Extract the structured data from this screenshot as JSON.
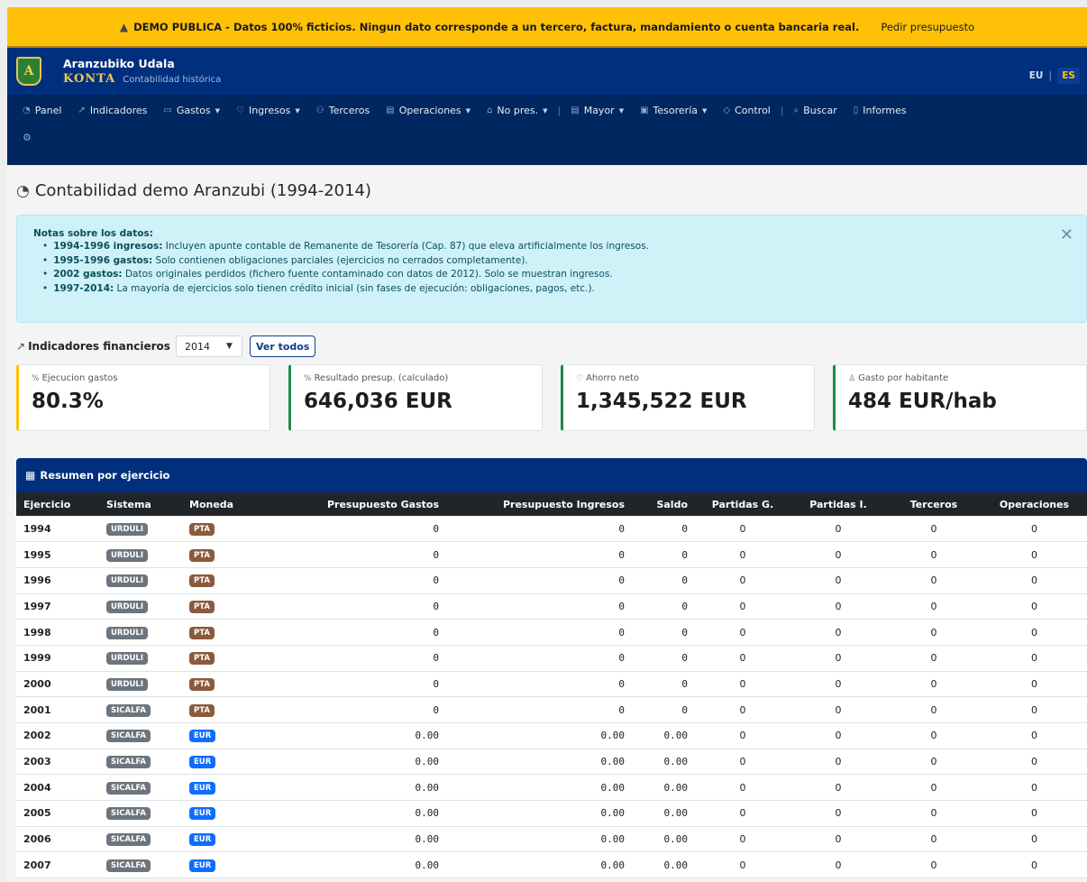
{
  "banner": {
    "message": "DEMO PUBLICA - Datos 100% ficticios. Ningun dato corresponde a un tercero, factura, mandamiento o cuenta bancaria real.",
    "cta": "Pedir presupuesto"
  },
  "brand": {
    "logo_letter": "A",
    "name": "Aranzubiko Udala",
    "product": "KONTA",
    "tagline": "Contabilidad histórica"
  },
  "lang": {
    "eu": "EU",
    "sep": "|",
    "es": "ES"
  },
  "nav": [
    {
      "label": "Panel",
      "icon": "dashboard-icon",
      "dropdown": false
    },
    {
      "label": "Indicadores",
      "icon": "chart-line-icon",
      "dropdown": false
    },
    {
      "label": "Gastos",
      "icon": "wallet-icon",
      "dropdown": true
    },
    {
      "label": "Ingresos",
      "icon": "piggy-bank-icon",
      "dropdown": true
    },
    {
      "label": "Terceros",
      "icon": "users-icon",
      "dropdown": false
    },
    {
      "label": "Operaciones",
      "icon": "document-list-icon",
      "dropdown": true
    },
    {
      "label": "No pres.",
      "icon": "bank-icon",
      "dropdown": true
    },
    {
      "label": "Mayor",
      "icon": "book-icon",
      "dropdown": true
    },
    {
      "label": "Tesorería",
      "icon": "safe-icon",
      "dropdown": true
    },
    {
      "label": "Control",
      "icon": "shield-check-icon",
      "dropdown": false
    },
    {
      "label": "Buscar",
      "icon": "search-icon",
      "dropdown": false
    },
    {
      "label": "Informes",
      "icon": "report-icon",
      "dropdown": false
    }
  ],
  "page": {
    "title": "Contabilidad demo Aranzubi (1994-2014)"
  },
  "alert": {
    "title": "Notas sobre los datos:",
    "items": [
      {
        "bold": "1994-1996 ingresos:",
        "text": " Incluyen apunte contable de Remanente de Tesorería (Cap. 87) que eleva artificialmente los ingresos."
      },
      {
        "bold": "1995-1996 gastos:",
        "text": " Solo contienen obligaciones parciales (ejercicios no cerrados completamente)."
      },
      {
        "bold": "2002 gastos:",
        "text": " Datos originales perdidos (fichero fuente contaminado con datos de 2012). Solo se muestran ingresos."
      },
      {
        "bold": "1997-2014:",
        "text": " La mayoría de ejercicios solo tienen crédito inicial (sin fases de ejecución: obligaciones, pagos, etc.)."
      }
    ]
  },
  "indicators": {
    "label": "Indicadores financieros",
    "year": "2014",
    "view_all": "Ver todos",
    "cards": [
      {
        "label": "Ejecucion gastos",
        "icon": "percent-icon",
        "value": "80.3%",
        "accent": "#ffc107"
      },
      {
        "label": "Resultado presup. (calculado)",
        "icon": "percent-icon",
        "value": "646,036 EUR",
        "accent": "#1f8a4c"
      },
      {
        "label": "Ahorro neto",
        "icon": "piggy-bank-icon",
        "value": "1,345,522 EUR",
        "accent": "#1f8a4c"
      },
      {
        "label": "Gasto por habitante",
        "icon": "person-icon",
        "value": "484 EUR/hab",
        "accent": "#1f8a4c"
      }
    ]
  },
  "table": {
    "title": "Resumen por ejercicio",
    "columns": [
      "Ejercicio",
      "Sistema",
      "Moneda",
      "Presupuesto Gastos",
      "Presupuesto Ingresos",
      "Saldo",
      "Partidas G.",
      "Partidas I.",
      "Terceros",
      "Operaciones"
    ],
    "rows": [
      {
        "year": "1994",
        "system": "URDULI",
        "currency": "PTA",
        "gastos": "0",
        "ingresos": "0",
        "saldo": "0",
        "partidas_g": "0",
        "partidas_i": "0",
        "terceros": "0",
        "operaciones": "0"
      },
      {
        "year": "1995",
        "system": "URDULI",
        "currency": "PTA",
        "gastos": "0",
        "ingresos": "0",
        "saldo": "0",
        "partidas_g": "0",
        "partidas_i": "0",
        "terceros": "0",
        "operaciones": "0"
      },
      {
        "year": "1996",
        "system": "URDULI",
        "currency": "PTA",
        "gastos": "0",
        "ingresos": "0",
        "saldo": "0",
        "partidas_g": "0",
        "partidas_i": "0",
        "terceros": "0",
        "operaciones": "0"
      },
      {
        "year": "1997",
        "system": "URDULI",
        "currency": "PTA",
        "gastos": "0",
        "ingresos": "0",
        "saldo": "0",
        "partidas_g": "0",
        "partidas_i": "0",
        "terceros": "0",
        "operaciones": "0"
      },
      {
        "year": "1998",
        "system": "URDULI",
        "currency": "PTA",
        "gastos": "0",
        "ingresos": "0",
        "saldo": "0",
        "partidas_g": "0",
        "partidas_i": "0",
        "terceros": "0",
        "operaciones": "0"
      },
      {
        "year": "1999",
        "system": "URDULI",
        "currency": "PTA",
        "gastos": "0",
        "ingresos": "0",
        "saldo": "0",
        "partidas_g": "0",
        "partidas_i": "0",
        "terceros": "0",
        "operaciones": "0"
      },
      {
        "year": "2000",
        "system": "URDULI",
        "currency": "PTA",
        "gastos": "0",
        "ingresos": "0",
        "saldo": "0",
        "partidas_g": "0",
        "partidas_i": "0",
        "terceros": "0",
        "operaciones": "0"
      },
      {
        "year": "2001",
        "system": "SICALFA",
        "currency": "PTA",
        "gastos": "0",
        "ingresos": "0",
        "saldo": "0",
        "partidas_g": "0",
        "partidas_i": "0",
        "terceros": "0",
        "operaciones": "0"
      },
      {
        "year": "2002",
        "system": "SICALFA",
        "currency": "EUR",
        "gastos": "0.00",
        "ingresos": "0.00",
        "saldo": "0.00",
        "partidas_g": "0",
        "partidas_i": "0",
        "terceros": "0",
        "operaciones": "0"
      },
      {
        "year": "2003",
        "system": "SICALFA",
        "currency": "EUR",
        "gastos": "0.00",
        "ingresos": "0.00",
        "saldo": "0.00",
        "partidas_g": "0",
        "partidas_i": "0",
        "terceros": "0",
        "operaciones": "0"
      },
      {
        "year": "2004",
        "system": "SICALFA",
        "currency": "EUR",
        "gastos": "0.00",
        "ingresos": "0.00",
        "saldo": "0.00",
        "partidas_g": "0",
        "partidas_i": "0",
        "terceros": "0",
        "operaciones": "0"
      },
      {
        "year": "2005",
        "system": "SICALFA",
        "currency": "EUR",
        "gastos": "0.00",
        "ingresos": "0.00",
        "saldo": "0.00",
        "partidas_g": "0",
        "partidas_i": "0",
        "terceros": "0",
        "operaciones": "0"
      },
      {
        "year": "2006",
        "system": "SICALFA",
        "currency": "EUR",
        "gastos": "0.00",
        "ingresos": "0.00",
        "saldo": "0.00",
        "partidas_g": "0",
        "partidas_i": "0",
        "terceros": "0",
        "operaciones": "0"
      },
      {
        "year": "2007",
        "system": "SICALFA",
        "currency": "EUR",
        "gastos": "0.00",
        "ingresos": "0.00",
        "saldo": "0.00",
        "partidas_g": "0",
        "partidas_i": "0",
        "terceros": "0",
        "operaciones": "0"
      }
    ]
  }
}
